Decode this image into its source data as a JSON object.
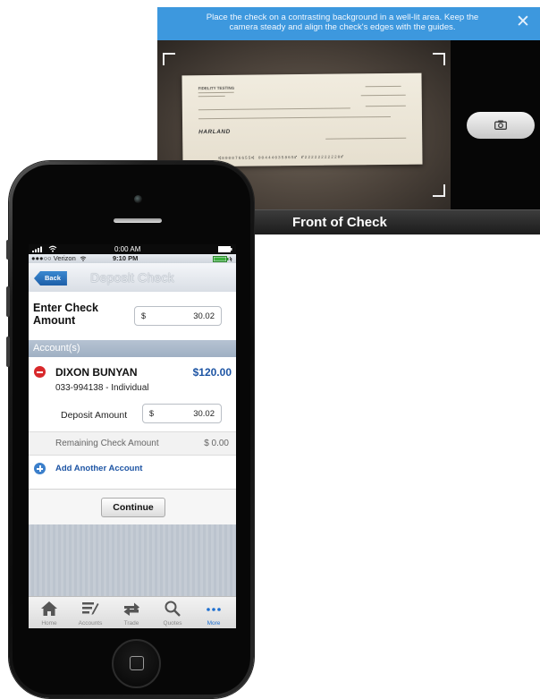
{
  "camera": {
    "instruction": "Place the check on a contrasting background in a well-lit area.  Keep the camera steady and align the check's edges with the guides.",
    "footer_title": "Front of Check",
    "check_image": {
      "bank_name": "FIDELITY TESTING",
      "brand": "HARLAND",
      "micr": "⑆000076655⑆  00444035865⑈   ⑈22222222220⑈"
    }
  },
  "phone": {
    "status_outer": {
      "time": "0:00 AM"
    },
    "status_inner": {
      "carrier": "●●●○○ Verizon",
      "time": "9:10 PM"
    },
    "nav": {
      "back_label": "Back",
      "title": "Deposit Check"
    },
    "check_amount": {
      "label": "Enter Check Amount",
      "currency": "$",
      "value": "30.02"
    },
    "accounts_header": "Account(s)",
    "account": {
      "name": "DIXON BUNYAN",
      "balance": "$120.00",
      "number_type": "033-994138 - Individual",
      "deposit_label": "Deposit Amount",
      "deposit_currency": "$",
      "deposit_value": "30.02"
    },
    "remaining": {
      "label": "Remaining Check Amount",
      "amount": "$ 0.00"
    },
    "add_account_label": "Add Another Account",
    "continue_label": "Continue",
    "tabs": [
      {
        "label": "Home",
        "icon": "home-icon"
      },
      {
        "label": "Accounts",
        "icon": "accounts-icon"
      },
      {
        "label": "Trade",
        "icon": "trade-icon"
      },
      {
        "label": "Quotes",
        "icon": "search-icon"
      },
      {
        "label": "More",
        "icon": "more-icon"
      }
    ],
    "active_tab": "More"
  },
  "colors": {
    "banner_blue": "#3d98de",
    "account_blue": "#1e55a4",
    "remove_red": "#d8282b",
    "accounts_header": "#aab9cb"
  }
}
